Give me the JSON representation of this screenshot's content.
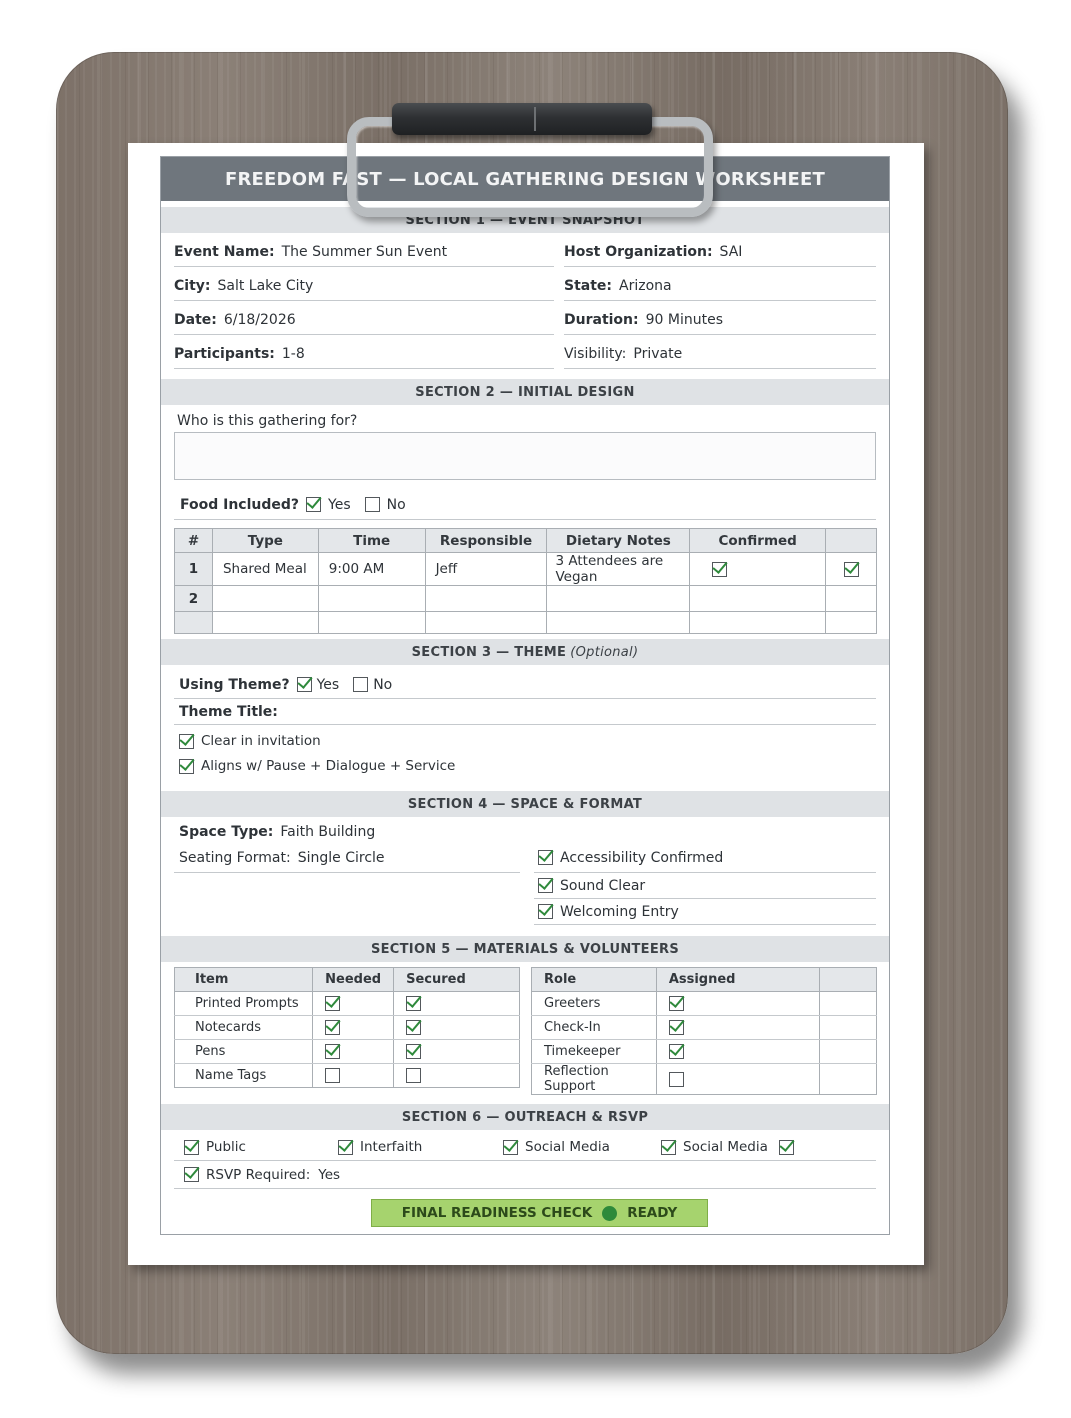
{
  "title": "FREEDOM FAST — LOCAL GATHERING DESIGN WORKSHEET",
  "section1": {
    "header": "SECTION 1 — EVENT SNAPSHOT",
    "event_name_label": "Event Name:",
    "event_name": "The Summer Sun Event",
    "host_label": "Host Organization:",
    "host": "SAI",
    "city_label": "City:",
    "city": "Salt Lake City",
    "state_label": "State:",
    "state": "Arizona",
    "date_label": "Date:",
    "date": "6/18/2026",
    "duration_label": "Duration:",
    "duration": "90 Minutes",
    "participants_label": "Participants:",
    "participants": "1-8",
    "visibility_label": "Visibility:",
    "visibility": "Private"
  },
  "section2": {
    "header": "SECTION 2 — INITIAL DESIGN",
    "question": "Who is this gathering for?",
    "food_label": "Food Included?",
    "yes": "Yes",
    "no": "No",
    "food_yes": true,
    "food_no": false,
    "table_headers": [
      "#",
      "Type",
      "Time",
      "Responsible",
      "Dietary Notes",
      "Confirmed",
      ""
    ],
    "rows": [
      {
        "num": "1",
        "type": "Shared Meal",
        "time": "9:00 AM",
        "responsible": "Jeff",
        "dietary": "3 Attendees are Vegan",
        "confirmed": true,
        "extra": true
      },
      {
        "num": "2",
        "type": "",
        "time": "",
        "responsible": "",
        "dietary": "",
        "confirmed": null,
        "extra": null
      },
      {
        "num": "",
        "type": "",
        "time": "",
        "responsible": "",
        "dietary": "",
        "confirmed": null,
        "extra": null
      }
    ]
  },
  "section3": {
    "header": "SECTION 3 — THEME",
    "header_optional": "(Optional)",
    "using_label": "Using Theme?",
    "yes": "Yes",
    "no": "No",
    "using_yes": true,
    "using_no": false,
    "theme_title_label": "Theme Title:",
    "checks": [
      {
        "label": "Clear in invitation",
        "checked": true
      },
      {
        "label": "Aligns w/ Pause + Dialogue + Service",
        "checked": true
      }
    ]
  },
  "section4": {
    "header": "SECTION 4 — SPACE & FORMAT",
    "space_label": "Space Type:",
    "space": "Faith Building",
    "seating_label": "Seating Format:",
    "seating": "Single Circle",
    "checks": [
      {
        "label": "Accessibility Confirmed",
        "checked": true
      },
      {
        "label": "Sound Clear",
        "checked": true
      },
      {
        "label": "Welcoming Entry",
        "checked": true
      }
    ]
  },
  "section5": {
    "header": "SECTION 5 — MATERIALS & VOLUNTEERS",
    "materials_headers": [
      "Item",
      "Needed",
      "Secured"
    ],
    "materials": [
      {
        "item": "Printed Prompts",
        "needed": true,
        "secured": true
      },
      {
        "item": "Notecards",
        "needed": true,
        "secured": true
      },
      {
        "item": "Pens",
        "needed": true,
        "secured": true
      },
      {
        "item": "Name Tags",
        "needed": false,
        "secured": false
      }
    ],
    "roles_headers": [
      "Role",
      "Assigned",
      ""
    ],
    "roles": [
      {
        "role": "Greeters",
        "assigned": true
      },
      {
        "role": "Check-In",
        "assigned": true
      },
      {
        "role": "Timekeeper",
        "assigned": true
      },
      {
        "role": "Reflection Support",
        "assigned": false
      }
    ]
  },
  "section6": {
    "header": "SECTION 6 — OUTREACH & RSVP",
    "checks": [
      {
        "label": "Public",
        "checked": true
      },
      {
        "label": "Interfaith",
        "checked": true
      },
      {
        "label": "Social Media",
        "checked": true
      },
      {
        "label": "Social Media",
        "checked": true
      }
    ],
    "trailing_checked": true,
    "rsvp_label": "RSVP Required:",
    "rsvp": "Yes",
    "rsvp_checked": true
  },
  "final": {
    "label": "FINAL READINESS CHECK",
    "status": "READY",
    "status_color": "#2d8a3a"
  }
}
